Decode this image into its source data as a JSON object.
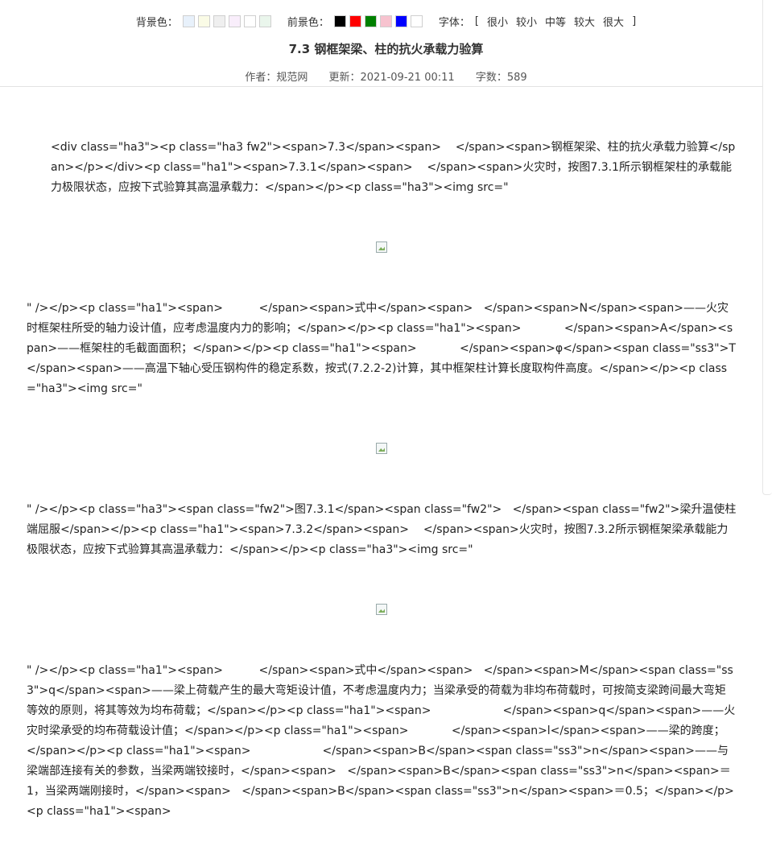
{
  "toolbar": {
    "bg_label": "背景色：",
    "bg_colors": [
      "#e8f1fb",
      "#fafbe6",
      "#efefef",
      "#f9eefb",
      "#ffffff",
      "#eaf6ec"
    ],
    "fg_label": "前景色：",
    "fg_colors": [
      "#000000",
      "#ff0000",
      "#008000",
      "#f7c3cf",
      "#0000ff",
      "#ffffff"
    ],
    "font_label": "字体：",
    "bracket_open": "[",
    "bracket_close": "]",
    "font_sizes": [
      "很小",
      "较小",
      "中等",
      "较大",
      "很大"
    ]
  },
  "article": {
    "title": "7.3 钢框架梁、柱的抗火承载力验算",
    "author": "作者：规范网",
    "updated": "更新：2021-09-21 00:11",
    "word_count": "字数：589"
  },
  "content": {
    "block1": "<div class=\"ha3\"><p class=\"ha3 fw2\"><span>7.3</span><span>    </span><span>钢框架梁、柱的抗火承载力验算</span></p></div><p class=\"ha1\"><span>7.3.1</span><span>    </span><span>火灾时，按图7.3.1所示钢框架柱的承载能力极限状态，应按下式验算其高温承载力：</span></p><p class=\"ha3\"><img src=\"",
    "block2": "\" /></p><p class=\"ha1\"><span>          </span><span>式中</span><span>   </span><span>N</span><span>——火灾时框架柱所受的轴力设计值，应考虑温度内力的影响；</span></p><p class=\"ha1\"><span>            </span><span>A</span><span>——框架柱的毛截面面积；</span></p><p class=\"ha1\"><span>            </span><span>φ</span><span class=\"ss3\">T</span><span>——高温下轴心受压钢构件的稳定系数，按式(7.2.2-2)计算，其中框架柱计算长度取构件高度。</span></p><p class=\"ha3\"><img src=\"",
    "block3": "\" /></p><p class=\"ha3\"><span class=\"fw2\">图7.3.1</span><span class=\"fw2\">   </span><span class=\"fw2\">梁升温使柱端屈服</span></p><p class=\"ha1\"><span>7.3.2</span><span>    </span><span>火灾时，按图7.3.2所示钢框架梁承载能力极限状态，应按下式验算其高温承载力：</span></p><p class=\"ha3\"><img src=\"",
    "block4": "\" /></p><p class=\"ha1\"><span>          </span><span>式中</span><span>   </span><span>M</span><span class=\"ss3\">q</span><span>——梁上荷载产生的最大弯矩设计值，不考虑温度内力；当梁承受的荷载为非均布荷载时，可按简支梁跨间最大弯矩等效的原则，将其等效为均布荷载；</span></p><p class=\"ha1\"><span>                    </span><span>q</span><span>——火灾时梁承受的均布荷载设计值；</span></p><p class=\"ha1\"><span>            </span><span>l</span><span>——梁的跨度；</span></p><p class=\"ha1\"><span>                    </span><span>B</span><span class=\"ss3\">n</span><span>——与梁端部连接有关的参数，当梁两端铰接时，</span><span>   </span><span>B</span><span class=\"ss3\">n</span><span>＝1，当梁两端刚接时，</span><span>   </span><span>B</span><span class=\"ss3\">n</span><span>＝0.5；</span></p><p class=\"ha1\"><span>"
  }
}
